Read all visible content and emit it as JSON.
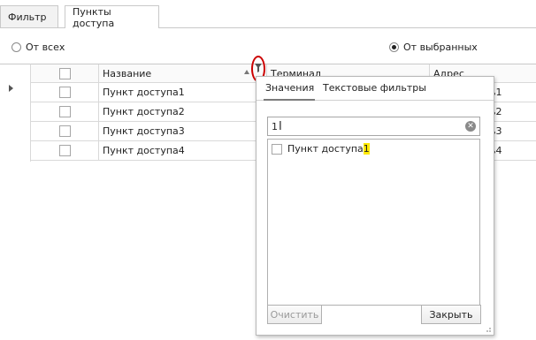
{
  "tabs": [
    {
      "label": "Фильтр"
    },
    {
      "label": "Пункты доступа"
    }
  ],
  "radios": {
    "all_label": "От всех",
    "selected_label": "От выбранных",
    "checked": "selected"
  },
  "grid": {
    "columns": [
      {
        "label": ""
      },
      {
        "label": "Название"
      },
      {
        "label": "Терминал"
      },
      {
        "label": "Адрес"
      }
    ],
    "rows": [
      {
        "name": "Пункт доступа1",
        "address_tail": "ь1"
      },
      {
        "name": "Пункт доступа2",
        "address_tail": "ь2"
      },
      {
        "name": "Пункт доступа3",
        "address_tail": "ь3"
      },
      {
        "name": "Пункт доступа4",
        "address_tail": "ь4"
      }
    ]
  },
  "filter_popup": {
    "tabs": [
      "Значения",
      "Текстовые фильтры"
    ],
    "active_tab": "Значения",
    "search_value": "1",
    "items": [
      {
        "text_prefix": "Пункт доступа",
        "text_match": "1",
        "checked": false
      }
    ],
    "clear_label": "Очистить",
    "close_label": "Закрыть"
  },
  "colors": {
    "filter_highlight": "#cc0000",
    "match_highlight": "#ffea00"
  }
}
